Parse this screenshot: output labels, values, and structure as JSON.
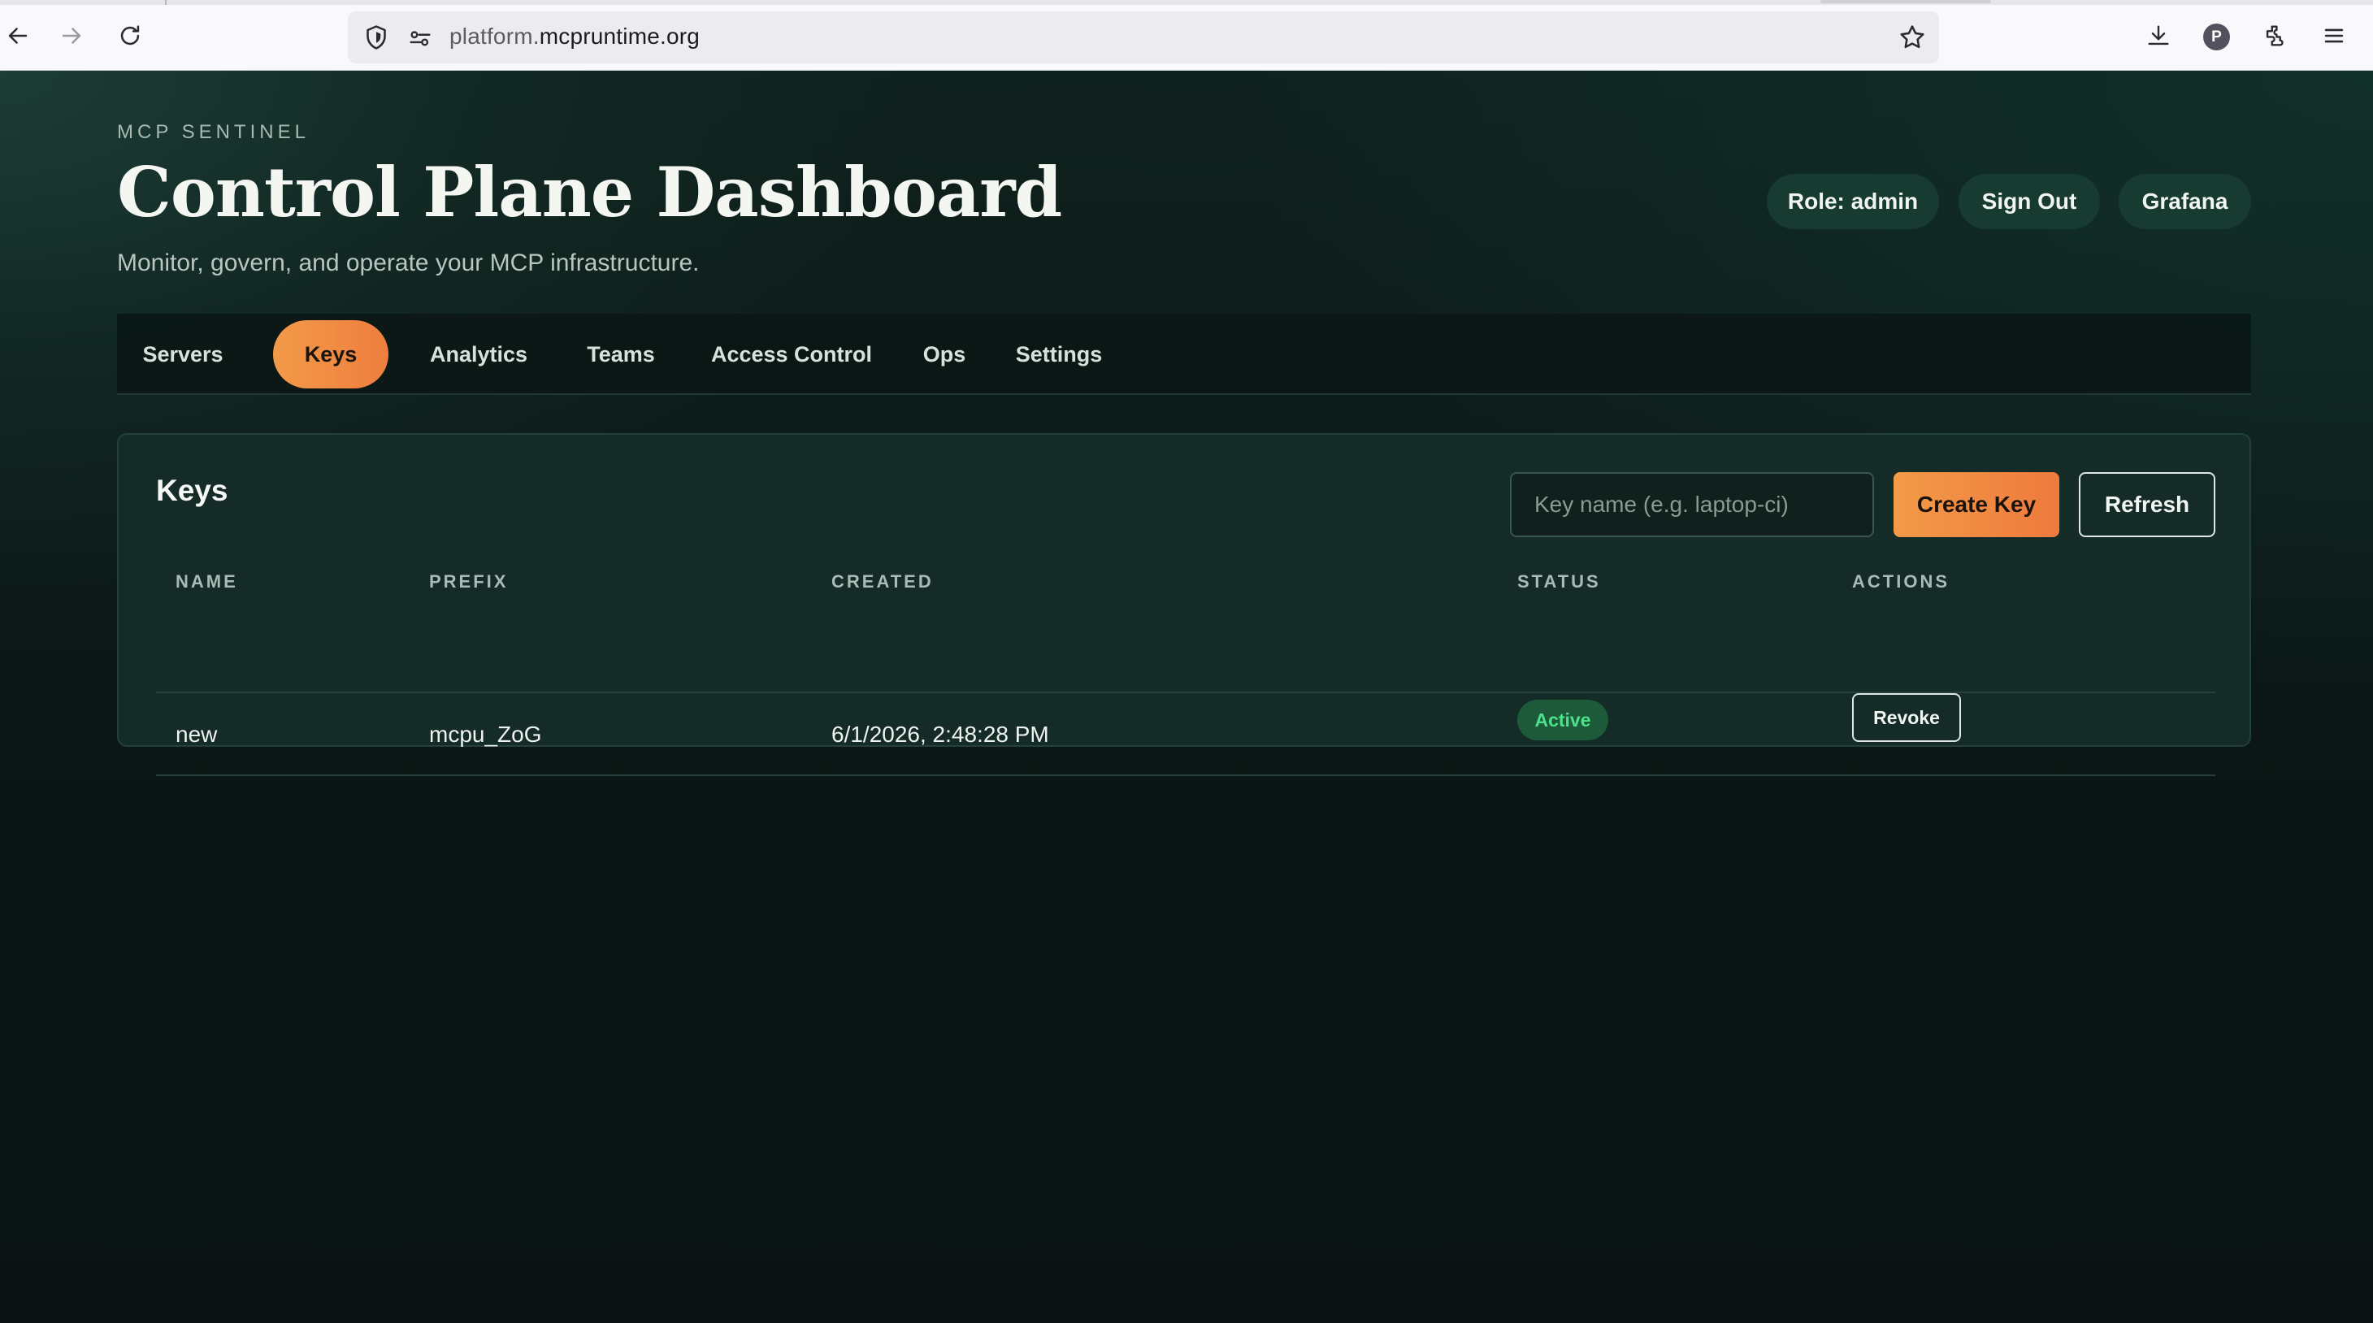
{
  "browser": {
    "url_prefix": "platform.",
    "url_host": "mcpruntime.org",
    "profile_initial": "P"
  },
  "header": {
    "eyebrow": "MCP SENTINEL",
    "title": "Control Plane Dashboard",
    "subtitle": "Monitor, govern, and operate your MCP infrastructure.",
    "role_label": "Role: admin",
    "sign_out_label": "Sign Out",
    "grafana_label": "Grafana"
  },
  "tabs": [
    {
      "label": "Servers",
      "active": false
    },
    {
      "label": "Keys",
      "active": true
    },
    {
      "label": "Analytics",
      "active": false
    },
    {
      "label": "Teams",
      "active": false
    },
    {
      "label": "Access Control",
      "active": false
    },
    {
      "label": "Ops",
      "active": false
    },
    {
      "label": "Settings",
      "active": false
    }
  ],
  "keys_panel": {
    "title": "Keys",
    "input_placeholder": "Key name (e.g. laptop-ci)",
    "create_label": "Create Key",
    "refresh_label": "Refresh",
    "columns": [
      "NAME",
      "PREFIX",
      "CREATED",
      "STATUS",
      "ACTIONS"
    ],
    "rows": [
      {
        "name": "new",
        "prefix": "mcpu_ZoG",
        "created": "6/1/2026, 2:48:28 PM",
        "status": "Active",
        "action": "Revoke"
      }
    ]
  },
  "colors": {
    "accent": "#f39a48",
    "pill_bg": "#173a31",
    "status_active": "#4ee08a"
  }
}
